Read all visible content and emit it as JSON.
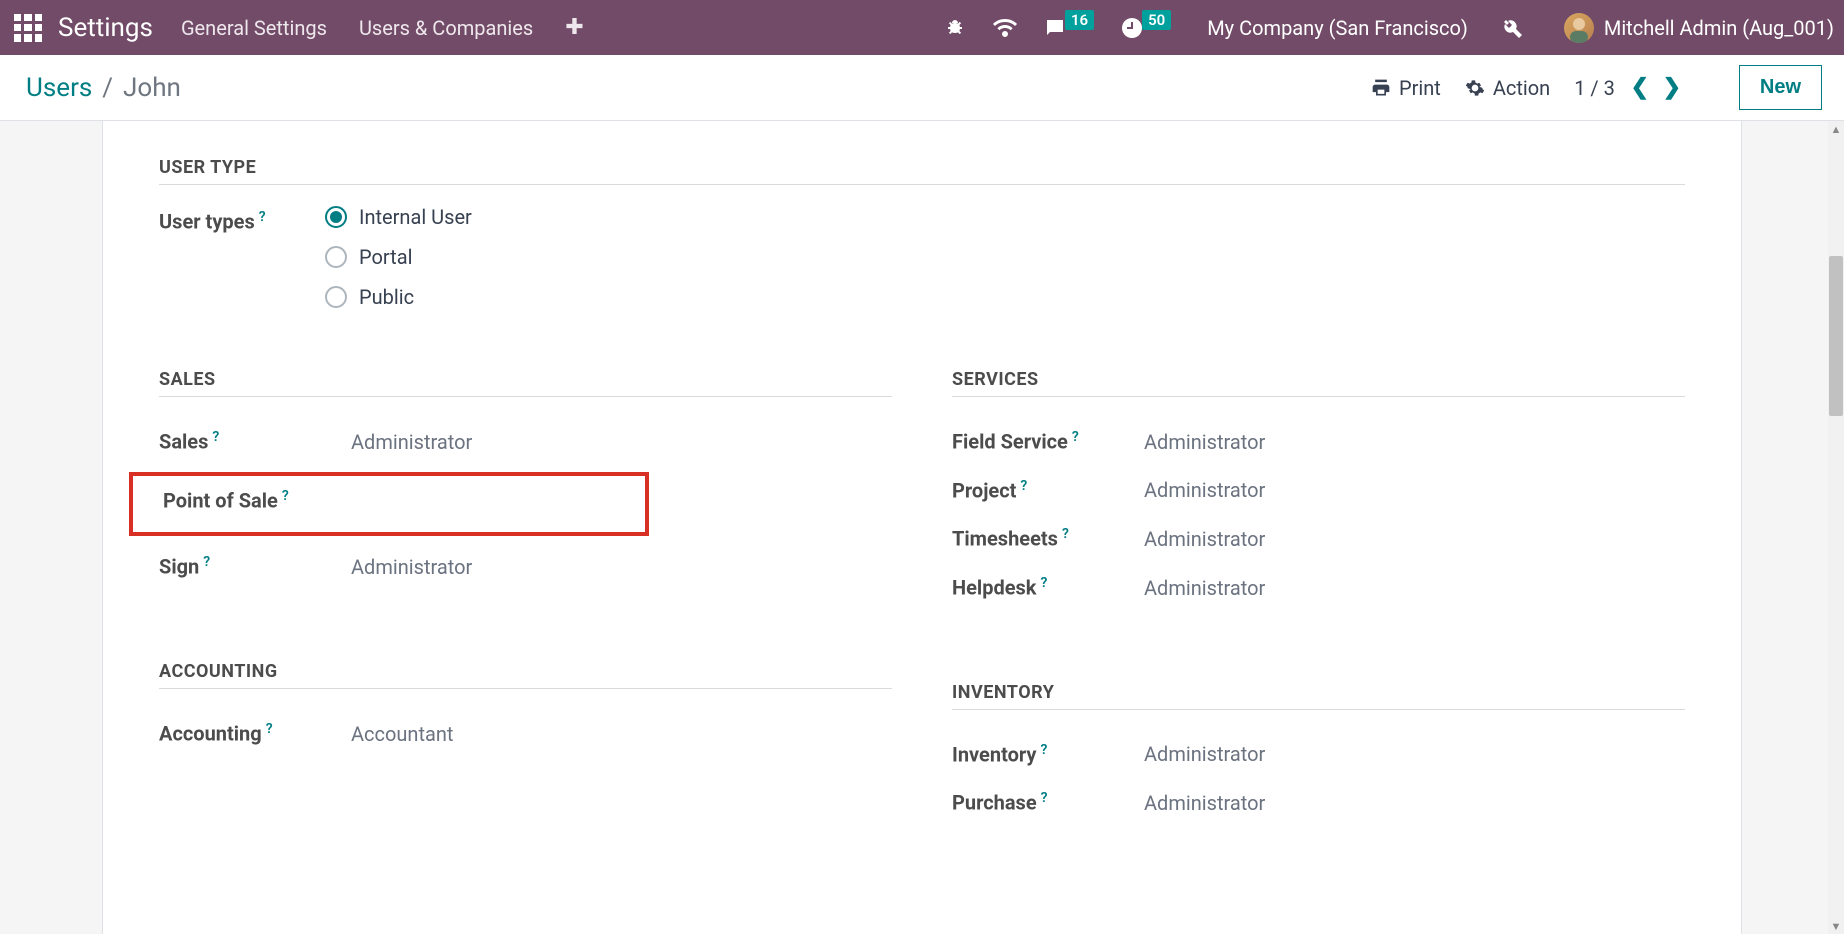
{
  "header": {
    "app_title": "Settings",
    "nav": {
      "general": "General Settings",
      "users": "Users & Companies"
    },
    "company": "My Company (San Francisco)",
    "messages_badge": "16",
    "activities_badge": "50",
    "user": "Mitchell Admin (Aug_001)"
  },
  "subheader": {
    "breadcrumb_root": "Users",
    "breadcrumb_current": "John",
    "print": "Print",
    "action": "Action",
    "pager": "1 / 3",
    "new_btn": "New"
  },
  "form": {
    "user_type_heading": "USER TYPE",
    "user_types_label": "User types",
    "user_types": {
      "internal": "Internal User",
      "portal": "Portal",
      "public": "Public"
    },
    "sales": {
      "heading": "SALES",
      "sales_label": "Sales",
      "sales_value": "Administrator",
      "pos_label": "Point of Sale",
      "pos_value": "",
      "sign_label": "Sign",
      "sign_value": "Administrator"
    },
    "services": {
      "heading": "SERVICES",
      "field_service_label": "Field Service",
      "field_service_value": "Administrator",
      "project_label": "Project",
      "project_value": "Administrator",
      "timesheets_label": "Timesheets",
      "timesheets_value": "Administrator",
      "helpdesk_label": "Helpdesk",
      "helpdesk_value": "Administrator"
    },
    "accounting": {
      "heading": "ACCOUNTING",
      "accounting_label": "Accounting",
      "accounting_value": "Accountant"
    },
    "inventory": {
      "heading": "INVENTORY",
      "inventory_label": "Inventory",
      "inventory_value": "Administrator",
      "purchase_label": "Purchase",
      "purchase_value": "Administrator"
    }
  }
}
